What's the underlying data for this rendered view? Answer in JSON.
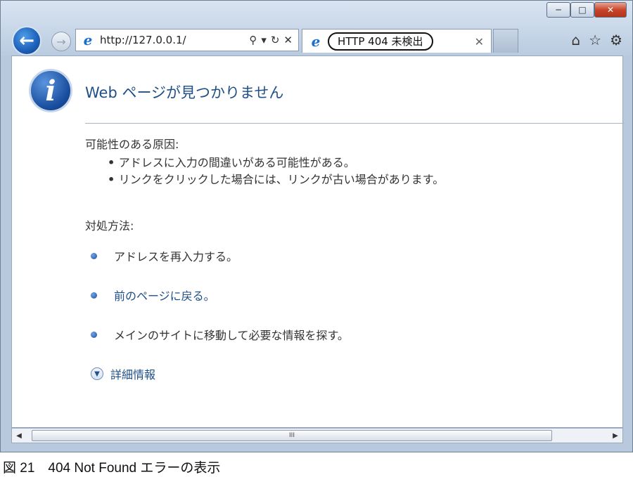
{
  "window": {
    "caption_buttons": [
      "─",
      "□",
      "✕"
    ]
  },
  "nav": {
    "back_icon": "←",
    "forward_icon": "→",
    "url": "http://127.0.0.1/",
    "search_icon": "⚲",
    "dropdown_icon": "▾",
    "refresh_icon": "↻",
    "stop_icon": "✕",
    "ie_logo_glyph": "e"
  },
  "tab": {
    "title": "HTTP 404 未検出",
    "close_icon": "✕"
  },
  "toolbar": {
    "home_icon": "⌂",
    "favorites_icon": "☆",
    "tools_icon": "⚙"
  },
  "page": {
    "info_glyph": "i",
    "title": "Web ページが見つかりません",
    "causes_heading": "可能性のある原因:",
    "causes": [
      "アドレスに入力の間違いがある可能性がある。",
      "リンクをクリックした場合には、リンクが古い場合があります。"
    ],
    "actions_heading": "対処方法:",
    "actions": [
      "アドレスを再入力する。",
      "前のページに戻る。",
      "メインのサイトに移動して必要な情報を探す。"
    ],
    "more_info": "詳細情報"
  },
  "scrollbar": {
    "left_arrow": "◀",
    "right_arrow": "▶",
    "grip": "III"
  },
  "figure_caption": "図 21　404 Not Found エラーの表示",
  "colors": {
    "link": "#1f4f88",
    "accent": "#1c5fb8",
    "close_button": "#c8452b"
  }
}
